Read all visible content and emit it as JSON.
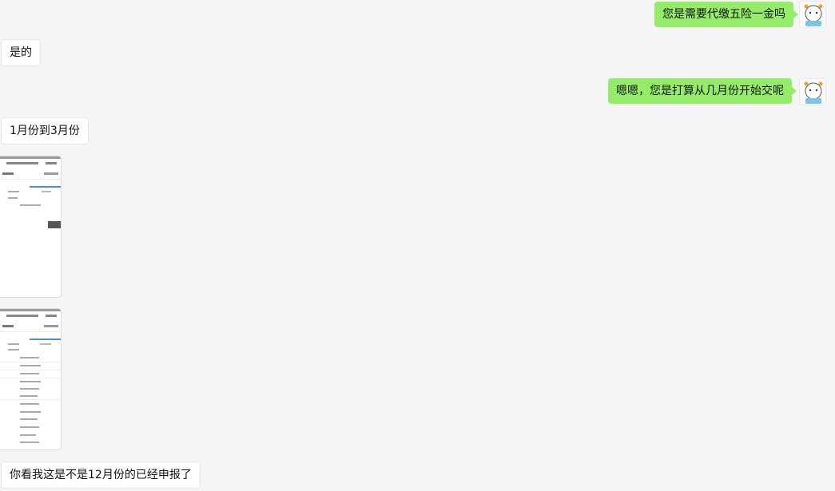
{
  "messages": [
    {
      "side": "self",
      "text": "您是需要代缴五险一金吗"
    },
    {
      "side": "other",
      "text": "是的"
    },
    {
      "side": "self",
      "text": "嗯嗯，您是打算从几月份开始交呢"
    },
    {
      "side": "other",
      "text": "1月份到3月份"
    },
    {
      "side": "other",
      "type": "image"
    },
    {
      "side": "other",
      "type": "image"
    },
    {
      "side": "other",
      "text": "你看我这是不是12月份的已经申报了"
    }
  ],
  "colors": {
    "background": "#f5f5f5",
    "self_bubble": "#95ec69",
    "other_bubble": "#ffffff"
  },
  "icons": {
    "avatar": "cartoon-avatar-icon",
    "edit": "edit-icon"
  }
}
